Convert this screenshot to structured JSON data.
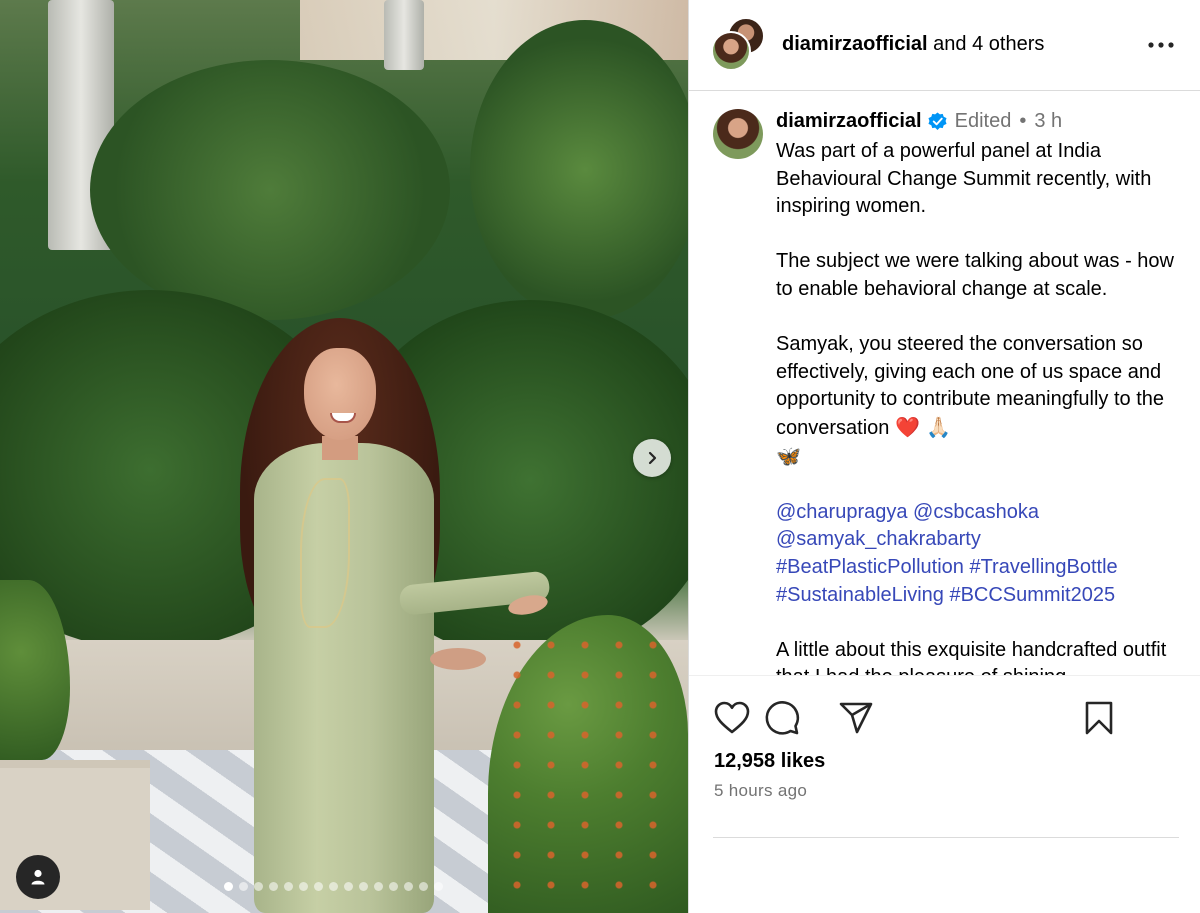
{
  "post": {
    "username": "diamirzaofficial",
    "coauthors_text": "and 4 others",
    "edited_label": "Edited",
    "separator": "•",
    "time_short": "3 h",
    "caption_paragraphs": [
      "Was part of a powerful panel at India Behavioural Change Summit recently, with inspiring women.",
      "The subject we were talking about was - how to enable behavioral change at scale.",
      "Samyak, you steered the conversation so effectively, giving each one of us space and opportunity to contribute meaningfully to the conversation"
    ],
    "caption_emojis": "❤️ 🙏🏻",
    "caption_emoji_line2": "🦋",
    "mentions_line1": "@charupragya @csbcashoka",
    "mentions_line2": "@samyak_chakrabarty",
    "hashtags_line1": "#BeatPlasticPollution #TravellingBottle",
    "hashtags_line2": "#SustainableLiving #BCCSummit2025",
    "caption_tail": "A little about this exquisite handcrafted outfit that I had the pleasure of shining",
    "likes": "12,958 likes",
    "time_ago": "5 hours ago"
  },
  "media": {
    "carousel_count": 15,
    "active_index": 0
  },
  "icons": {
    "like": "heart-icon",
    "comment": "comment-icon",
    "share": "send-icon",
    "save": "bookmark-icon",
    "more": "more-options-icon",
    "next": "chevron-right-icon",
    "tagged": "user-icon",
    "verified": "verified-badge-icon"
  },
  "colors": {
    "verified": "#0095f6",
    "link": "#00376b",
    "hashtag": "#3748b8",
    "secondary_text": "#737373"
  }
}
